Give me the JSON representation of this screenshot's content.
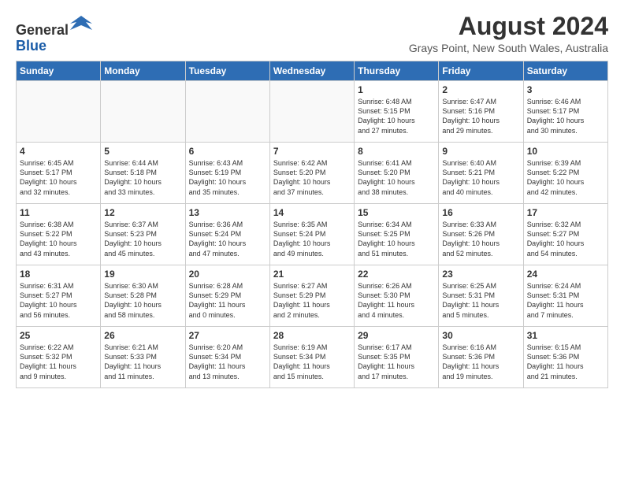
{
  "header": {
    "logo_line1": "General",
    "logo_line2": "Blue",
    "month_year": "August 2024",
    "location": "Grays Point, New South Wales, Australia"
  },
  "weekdays": [
    "Sunday",
    "Monday",
    "Tuesday",
    "Wednesday",
    "Thursday",
    "Friday",
    "Saturday"
  ],
  "weeks": [
    [
      {
        "day": "",
        "info": ""
      },
      {
        "day": "",
        "info": ""
      },
      {
        "day": "",
        "info": ""
      },
      {
        "day": "",
        "info": ""
      },
      {
        "day": "1",
        "info": "Sunrise: 6:48 AM\nSunset: 5:15 PM\nDaylight: 10 hours\nand 27 minutes."
      },
      {
        "day": "2",
        "info": "Sunrise: 6:47 AM\nSunset: 5:16 PM\nDaylight: 10 hours\nand 29 minutes."
      },
      {
        "day": "3",
        "info": "Sunrise: 6:46 AM\nSunset: 5:17 PM\nDaylight: 10 hours\nand 30 minutes."
      }
    ],
    [
      {
        "day": "4",
        "info": "Sunrise: 6:45 AM\nSunset: 5:17 PM\nDaylight: 10 hours\nand 32 minutes."
      },
      {
        "day": "5",
        "info": "Sunrise: 6:44 AM\nSunset: 5:18 PM\nDaylight: 10 hours\nand 33 minutes."
      },
      {
        "day": "6",
        "info": "Sunrise: 6:43 AM\nSunset: 5:19 PM\nDaylight: 10 hours\nand 35 minutes."
      },
      {
        "day": "7",
        "info": "Sunrise: 6:42 AM\nSunset: 5:20 PM\nDaylight: 10 hours\nand 37 minutes."
      },
      {
        "day": "8",
        "info": "Sunrise: 6:41 AM\nSunset: 5:20 PM\nDaylight: 10 hours\nand 38 minutes."
      },
      {
        "day": "9",
        "info": "Sunrise: 6:40 AM\nSunset: 5:21 PM\nDaylight: 10 hours\nand 40 minutes."
      },
      {
        "day": "10",
        "info": "Sunrise: 6:39 AM\nSunset: 5:22 PM\nDaylight: 10 hours\nand 42 minutes."
      }
    ],
    [
      {
        "day": "11",
        "info": "Sunrise: 6:38 AM\nSunset: 5:22 PM\nDaylight: 10 hours\nand 43 minutes."
      },
      {
        "day": "12",
        "info": "Sunrise: 6:37 AM\nSunset: 5:23 PM\nDaylight: 10 hours\nand 45 minutes."
      },
      {
        "day": "13",
        "info": "Sunrise: 6:36 AM\nSunset: 5:24 PM\nDaylight: 10 hours\nand 47 minutes."
      },
      {
        "day": "14",
        "info": "Sunrise: 6:35 AM\nSunset: 5:24 PM\nDaylight: 10 hours\nand 49 minutes."
      },
      {
        "day": "15",
        "info": "Sunrise: 6:34 AM\nSunset: 5:25 PM\nDaylight: 10 hours\nand 51 minutes."
      },
      {
        "day": "16",
        "info": "Sunrise: 6:33 AM\nSunset: 5:26 PM\nDaylight: 10 hours\nand 52 minutes."
      },
      {
        "day": "17",
        "info": "Sunrise: 6:32 AM\nSunset: 5:27 PM\nDaylight: 10 hours\nand 54 minutes."
      }
    ],
    [
      {
        "day": "18",
        "info": "Sunrise: 6:31 AM\nSunset: 5:27 PM\nDaylight: 10 hours\nand 56 minutes."
      },
      {
        "day": "19",
        "info": "Sunrise: 6:30 AM\nSunset: 5:28 PM\nDaylight: 10 hours\nand 58 minutes."
      },
      {
        "day": "20",
        "info": "Sunrise: 6:28 AM\nSunset: 5:29 PM\nDaylight: 11 hours\nand 0 minutes."
      },
      {
        "day": "21",
        "info": "Sunrise: 6:27 AM\nSunset: 5:29 PM\nDaylight: 11 hours\nand 2 minutes."
      },
      {
        "day": "22",
        "info": "Sunrise: 6:26 AM\nSunset: 5:30 PM\nDaylight: 11 hours\nand 4 minutes."
      },
      {
        "day": "23",
        "info": "Sunrise: 6:25 AM\nSunset: 5:31 PM\nDaylight: 11 hours\nand 5 minutes."
      },
      {
        "day": "24",
        "info": "Sunrise: 6:24 AM\nSunset: 5:31 PM\nDaylight: 11 hours\nand 7 minutes."
      }
    ],
    [
      {
        "day": "25",
        "info": "Sunrise: 6:22 AM\nSunset: 5:32 PM\nDaylight: 11 hours\nand 9 minutes."
      },
      {
        "day": "26",
        "info": "Sunrise: 6:21 AM\nSunset: 5:33 PM\nDaylight: 11 hours\nand 11 minutes."
      },
      {
        "day": "27",
        "info": "Sunrise: 6:20 AM\nSunset: 5:34 PM\nDaylight: 11 hours\nand 13 minutes."
      },
      {
        "day": "28",
        "info": "Sunrise: 6:19 AM\nSunset: 5:34 PM\nDaylight: 11 hours\nand 15 minutes."
      },
      {
        "day": "29",
        "info": "Sunrise: 6:17 AM\nSunset: 5:35 PM\nDaylight: 11 hours\nand 17 minutes."
      },
      {
        "day": "30",
        "info": "Sunrise: 6:16 AM\nSunset: 5:36 PM\nDaylight: 11 hours\nand 19 minutes."
      },
      {
        "day": "31",
        "info": "Sunrise: 6:15 AM\nSunset: 5:36 PM\nDaylight: 11 hours\nand 21 minutes."
      }
    ]
  ]
}
